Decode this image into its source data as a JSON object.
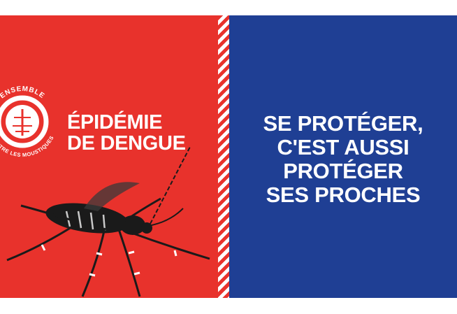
{
  "colors": {
    "red": "#e8322c",
    "blue": "#1f3f94",
    "white": "#ffffff"
  },
  "logo": {
    "icon": "mosquito-target-icon",
    "ring_top_text": "ENSEMBLE",
    "ring_bottom_text": "CONTRE LES MOUSTIQUES"
  },
  "left": {
    "line1": "ÉPIDÉMIE",
    "line2": "DE DENGUE",
    "illustration": "mosquito-icon"
  },
  "right": {
    "lines": [
      "SE PROTÉGER,",
      "C'EST AUSSI",
      "PROTÉGER",
      "SES PROCHES"
    ]
  }
}
